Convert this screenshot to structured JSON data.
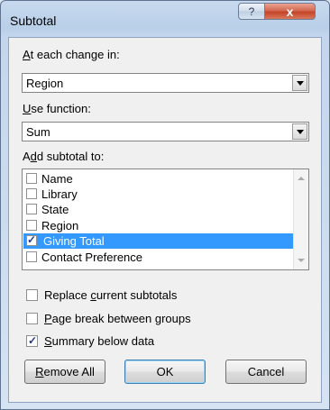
{
  "window": {
    "title": "Subtotal",
    "help_label": "?",
    "close_label": "x"
  },
  "change_in": {
    "label_hotkey": "A",
    "label_rest": "t each change in:",
    "value": "Region"
  },
  "use_function": {
    "label_hotkey": "U",
    "label_rest": "se function:",
    "value": "Sum"
  },
  "add_subtotal": {
    "label_pre": "A",
    "label_hotkey": "d",
    "label_rest": "d subtotal to:",
    "items": [
      {
        "label": "Name",
        "checked": false
      },
      {
        "label": "Library",
        "checked": false
      },
      {
        "label": "State",
        "checked": false
      },
      {
        "label": "Region",
        "checked": false
      },
      {
        "label": "Giving Total",
        "checked": true
      },
      {
        "label": "Contact Preference",
        "checked": false
      }
    ]
  },
  "options": {
    "replace": {
      "pre": "Replace ",
      "hotkey": "c",
      "rest": "urrent subtotals",
      "checked": false
    },
    "page_break": {
      "pre": "",
      "hotkey": "P",
      "rest": "age break between groups",
      "checked": false
    },
    "summary": {
      "pre": "",
      "hotkey": "S",
      "rest": "ummary below data",
      "checked": true
    }
  },
  "buttons": {
    "remove_hotkey": "R",
    "remove_rest": "emove All",
    "ok": "OK",
    "cancel": "Cancel"
  },
  "colors": {
    "selection": "#3399ff",
    "close_button": "#c44428"
  },
  "icons": {
    "check": "✓"
  }
}
